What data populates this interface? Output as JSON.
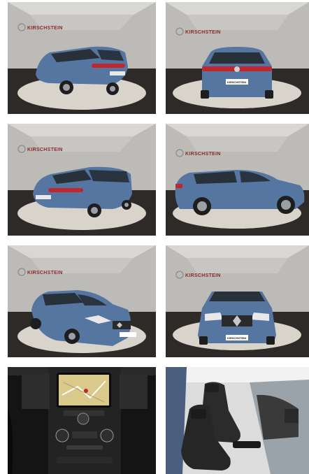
{
  "gallery": {
    "dealer_logo_text": "KIRSCHSTEIN",
    "plate_text": "KIRSCHSTEIN",
    "photos": [
      {
        "name": "rear-left-three-quarter",
        "view": "rear-left"
      },
      {
        "name": "rear",
        "view": "rear"
      },
      {
        "name": "rear-left-high",
        "view": "rear-left-high"
      },
      {
        "name": "side-right",
        "view": "side"
      },
      {
        "name": "front-left-three-quarter",
        "view": "front-left"
      },
      {
        "name": "front",
        "view": "front"
      },
      {
        "name": "interior-dashboard",
        "view": "dashboard"
      },
      {
        "name": "interior-front-seats",
        "view": "seats"
      }
    ]
  },
  "colors": {
    "car_blue": "#5576a0",
    "floor_dark": "#2e2a28",
    "wall_grey": "#b9b7b4",
    "turntable": "#d8d4cc",
    "taillight": "#c0272d"
  }
}
